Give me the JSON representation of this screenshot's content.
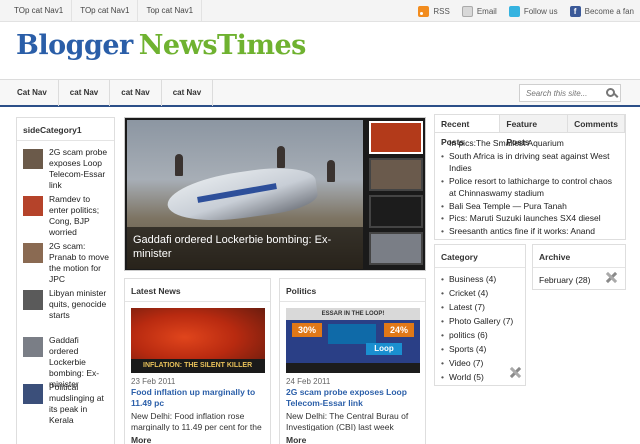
{
  "topnav": {
    "items": [
      "TOp cat Nav1",
      "TOp cat Nav1",
      "Top cat Nav1"
    ]
  },
  "social": {
    "rss": "RSS",
    "email": "Email",
    "twitter": "Follow us",
    "facebook": "Become a fan"
  },
  "logo": {
    "part1": "Blogger",
    "part2": "NewsTimes"
  },
  "catnav": {
    "items": [
      "Cat Nav",
      "cat Nav",
      "cat Nav",
      "cat Nav"
    ]
  },
  "search": {
    "placeholder": "Search this site..."
  },
  "sidebar_left": {
    "title": "sideCategory1",
    "items": [
      {
        "text": "2G scam probe exposes Loop Telecom-Essar link",
        "color": "#6b5a4a"
      },
      {
        "text": "Ramdev to enter politics; Cong, BJP worried",
        "color": "#b5432a"
      },
      {
        "text": "2G scam: Pranab to move the motion for JPC",
        "color": "#8a6a52"
      },
      {
        "text": "Libyan minister quits, genocide starts",
        "color": "#5a5a5a"
      },
      {
        "text": "Gaddafi ordered Lockerbie bombing: Ex-minister",
        "color": "#7a7e86"
      },
      {
        "text": "Political mudslinging at its peak in Kerala",
        "color": "#3b4f7a"
      }
    ]
  },
  "featured": {
    "caption": "Gaddafi ordered Lockerbie bombing: Ex-minister",
    "thumbs": [
      {
        "color": "#b33a1a"
      },
      {
        "color": "#6a5a4c"
      },
      {
        "color": "#1c1c1c"
      },
      {
        "color": "#7a7e86"
      }
    ]
  },
  "tabs": {
    "labels": [
      "Recent Posts",
      "Feature Posts",
      "Comments"
    ],
    "recent_posts": [
      "In pics:The Smallest Aquarium",
      "South Africa is in driving seat against West Indies",
      "Police resort to lathicharge to control chaos at Chinnaswamy stadium",
      "Bali Sea Temple — Pura Tanah",
      "Pics: Maruti Suzuki launches SX4 diesel",
      "Sreesanth antics fine if it works: Anand"
    ]
  },
  "category_box": {
    "title": "Category",
    "items": [
      "Business (4)",
      "Cricket (4)",
      "Latest (7)",
      "Photo Gallery (7)",
      "politics (6)",
      "Sports (4)",
      "Video (7)",
      "World (5)"
    ]
  },
  "archive_box": {
    "title": "Archive",
    "value": "February (28)"
  },
  "latest_news": {
    "title": "Latest News",
    "image_caption": "INFLATION: THE SILENT KILLER",
    "date": "23 Feb 2011",
    "headline": "Food inflation up marginally to 11.49 pc",
    "excerpt": "New Delhi: Food inflation rose marginally to 11.49 per cent for the week...",
    "more": "More"
  },
  "politics": {
    "title": "Politics",
    "image_heading": "ESSAR IN THE LOOP!",
    "image_left_pct": "30%",
    "image_right_pct": "24%",
    "image_loop": "Loop",
    "date": "24 Feb 2011",
    "headline": "2G scam probe exposes Loop Telecom-Essar link",
    "excerpt": "New Delhi: The Central Burau of Investigation (CBI) last week question...",
    "more": "More"
  },
  "colors": {
    "brand_blue": "#2a5ea8",
    "brand_green": "#6fb230",
    "nav_border": "#2c4f88",
    "link": "#2b5fa9"
  }
}
